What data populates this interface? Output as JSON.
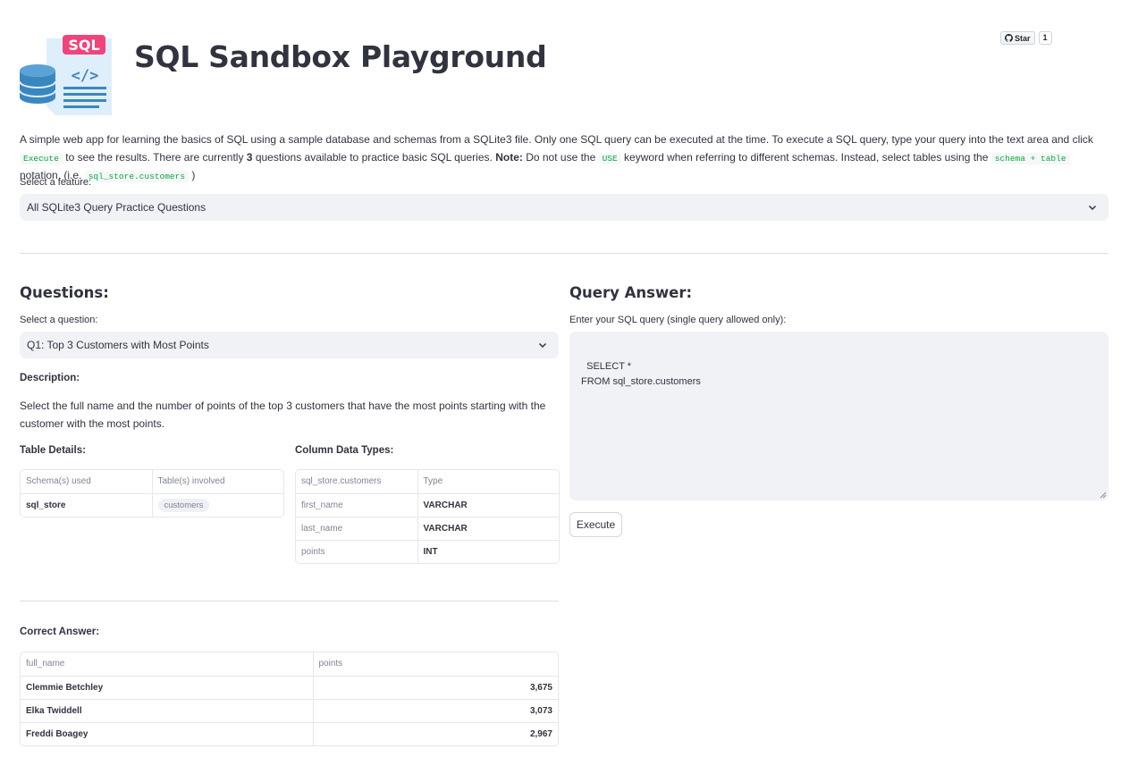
{
  "header": {
    "logo_label": "SQL",
    "title": "SQL Sandbox Playground"
  },
  "github": {
    "star_label": "Star",
    "star_count": "1"
  },
  "intro": {
    "p1": "A simple web app for learning the basics of SQL using a sample database and schemas from a SQLite3 file. Only one SQL query can be executed at the time. To execute a SQL query, type your query into the text area and click ",
    "code_execute": "Execute",
    "p2": " to see the results. There are currently ",
    "question_count": "3",
    "p3": " questions available to practice basic SQL queries. ",
    "note_label": "Note:",
    "p4": " Do not use the ",
    "code_use": "USE",
    "p5": " keyword when referring to different schemas. Instead, select tables using the ",
    "code_schema_table": "schema + table",
    "p6": " notation. (i.e. ",
    "code_example": "sql_store.customers",
    "p7": " )"
  },
  "feature_select": {
    "label": "Select a feature:",
    "value": "All SQLite3 Query Practice Questions"
  },
  "questions": {
    "heading": "Questions:",
    "select_label": "Select a question:",
    "selected": "Q1: Top 3 Customers with Most Points",
    "description_label": "Description:",
    "description": "Select the full name and the number of points of the top 3 customers that have the most points starting with the customer with the most points.",
    "table_details": {
      "label": "Table Details:",
      "headers": [
        "Schema(s) used",
        "Table(s) involved"
      ],
      "rows": [
        [
          "sql_store",
          "customers"
        ]
      ]
    },
    "column_types": {
      "label": "Column Data Types:",
      "headers": [
        "sql_store.customers",
        "Type"
      ],
      "rows": [
        [
          "first_name",
          "VARCHAR"
        ],
        [
          "last_name",
          "VARCHAR"
        ],
        [
          "points",
          "INT"
        ]
      ]
    },
    "correct_answer": {
      "label": "Correct Answer:",
      "headers": [
        "full_name",
        "points"
      ],
      "rows": [
        [
          "Clemmie Betchley",
          "3,675"
        ],
        [
          "Elka Twiddell",
          "3,073"
        ],
        [
          "Freddi Boagey",
          "2,967"
        ]
      ]
    }
  },
  "query": {
    "heading": "Query Answer:",
    "input_label": "Enter your SQL query (single query allowed only):",
    "value": "SELECT *\nFROM sql_store.customers",
    "execute_label": "Execute"
  },
  "icons": {
    "chevron": "chevron-down-icon",
    "github": "github-icon",
    "logo": "sql-database-icon"
  },
  "colors": {
    "logo_pink": "#f0457a",
    "logo_blue": "#3a87c0",
    "code_green": "#09ab3b",
    "input_bg": "#f0f2f6"
  }
}
